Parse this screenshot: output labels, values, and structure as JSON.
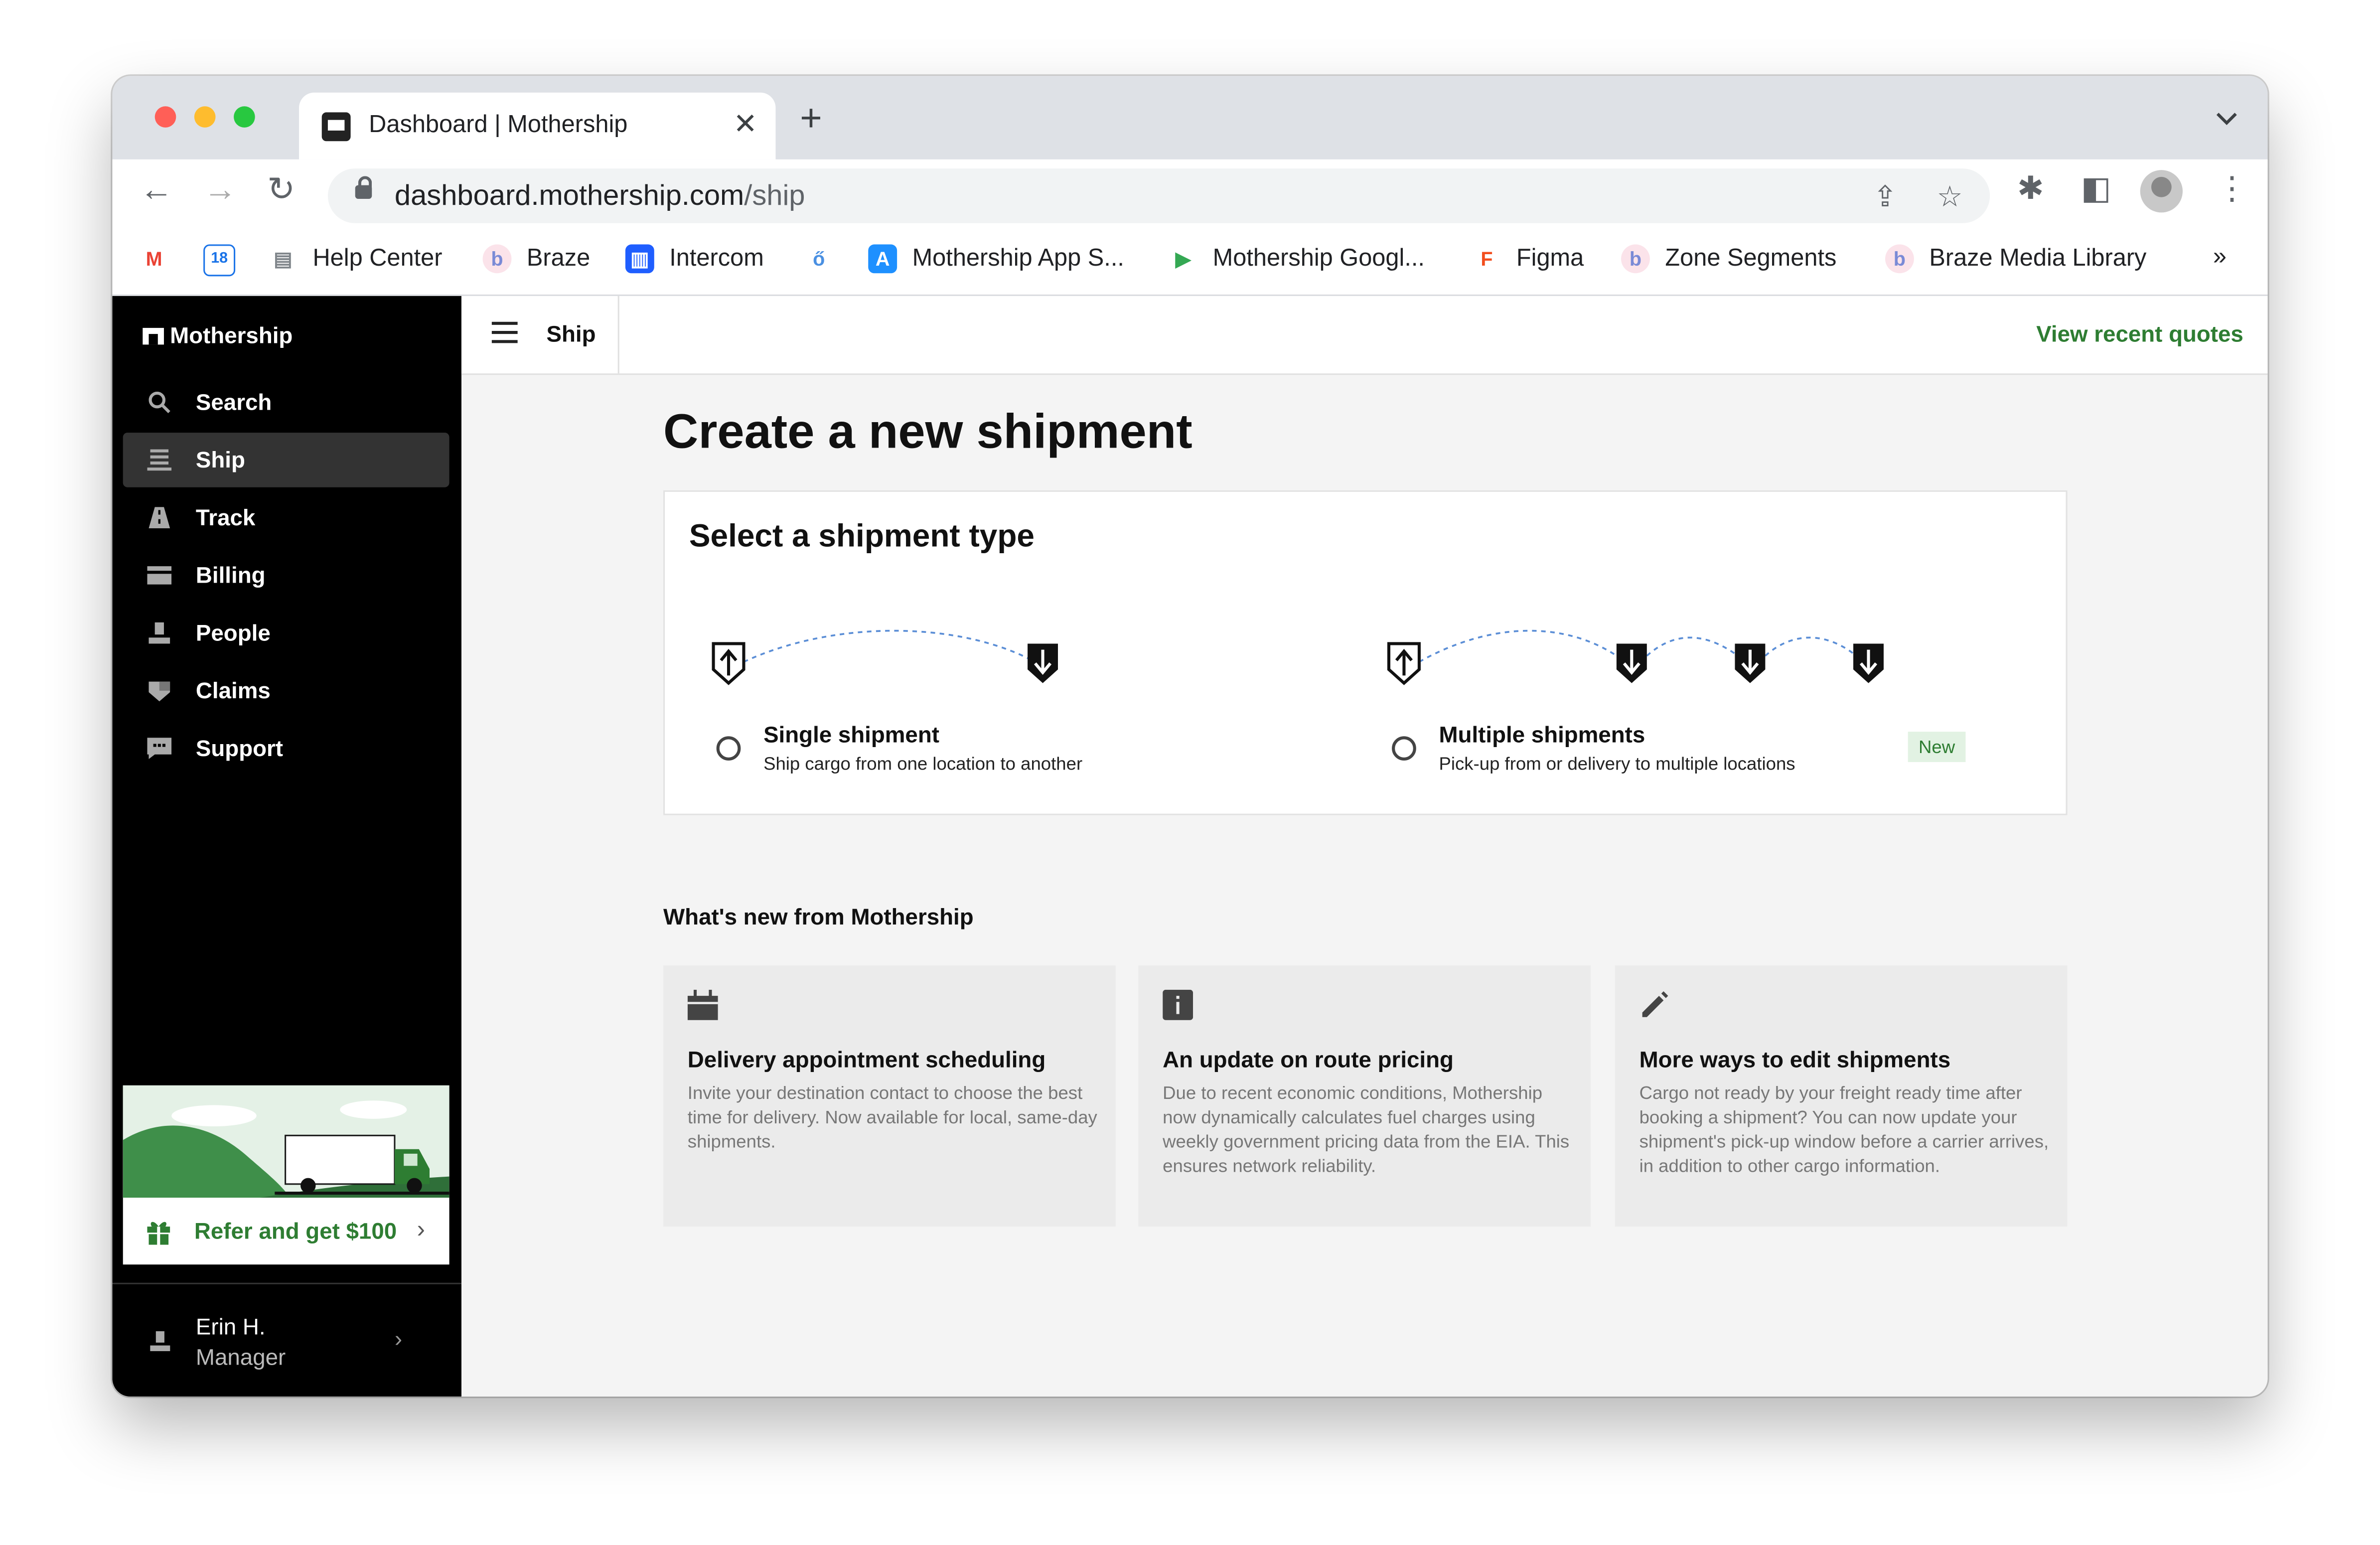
{
  "browser": {
    "tab_title": "Dashboard | Mothership",
    "tab_close": "✕",
    "new_tab": "+",
    "url_host": "dashboard.mothership.com",
    "url_path": "/ship",
    "bookmarks": [
      {
        "label": "",
        "icon": "gmail-icon",
        "color": "#ea4335",
        "glyph": "M"
      },
      {
        "label": "",
        "icon": "calendar-icon",
        "color": "#1a73e8",
        "glyph": "18"
      },
      {
        "label": "Help Center",
        "icon": "book-icon",
        "color": "#9aa0a6",
        "glyph": "▤"
      },
      {
        "label": "Braze",
        "icon": "braze-icon",
        "color": "#f4a6b8",
        "glyph": "b"
      },
      {
        "label": "Intercom",
        "icon": "intercom-icon",
        "color": "#1f5eff",
        "glyph": "▥"
      },
      {
        "label": "",
        "icon": "figure-icon",
        "color": "#4a90e2",
        "glyph": "ő"
      },
      {
        "label": "Mothership App S...",
        "icon": "app-store-icon",
        "color": "#1e90ff",
        "glyph": "A"
      },
      {
        "label": "Mothership Googl...",
        "icon": "google-play-icon",
        "color": "#34a853",
        "glyph": "▶"
      },
      {
        "label": "Figma",
        "icon": "figma-icon",
        "color": "#f24e1e",
        "glyph": "F"
      },
      {
        "label": "Zone Segments",
        "icon": "braze-icon",
        "color": "#f4a6b8",
        "glyph": "b"
      },
      {
        "label": "Braze Media Library",
        "icon": "braze-icon",
        "color": "#f4a6b8",
        "glyph": "b"
      }
    ],
    "more_bookmarks": "»"
  },
  "sidebar": {
    "logo": "Mothership",
    "items": [
      {
        "label": "Search",
        "icon": "search-icon",
        "glyph": "⚲",
        "active": false
      },
      {
        "label": "Ship",
        "icon": "ship-icon",
        "glyph": "☰",
        "active": true
      },
      {
        "label": "Track",
        "icon": "road-icon",
        "glyph": "▲",
        "active": false
      },
      {
        "label": "Billing",
        "icon": "credit-card-icon",
        "glyph": "▬",
        "active": false
      },
      {
        "label": "People",
        "icon": "person-icon",
        "glyph": "⏏",
        "active": false
      },
      {
        "label": "Claims",
        "icon": "shield-icon",
        "glyph": "⛉",
        "active": false
      },
      {
        "label": "Support",
        "icon": "chat-icon",
        "glyph": "▪",
        "active": false
      }
    ],
    "promo_label": "Refer and get $100",
    "promo_chevron": "›",
    "user_name": "Erin H.",
    "user_role": "Manager",
    "user_chevron": "›"
  },
  "header": {
    "title": "Ship",
    "recent_quotes": "View recent quotes"
  },
  "main": {
    "title": "Create a new shipment",
    "card_title": "Select a shipment type",
    "options": [
      {
        "title": "Single shipment",
        "subtitle": "Ship cargo from one location to another"
      },
      {
        "title": "Multiple shipments",
        "subtitle": "Pick-up from or delivery to multiple locations",
        "badge": "New"
      }
    ],
    "whats_new_title": "What's new from Mothership",
    "news": [
      {
        "icon": "calendar-icon",
        "title": "Delivery appointment scheduling",
        "body": "Invite your destination contact to choose the best time for delivery. Now available for local, same-day shipments."
      },
      {
        "icon": "info-icon",
        "title": "An update on route pricing",
        "body": "Due to recent economic conditions, Mothership now dynamically calculates fuel charges using weekly government pricing data from the EIA. This ensures network reliability."
      },
      {
        "icon": "pencil-icon",
        "title": "More ways to edit shipments",
        "body": "Cargo not ready by your freight ready time after booking a shipment? You can now update your shipment's pick-up window before a carrier arrives, in addition to other cargo information."
      }
    ]
  },
  "colors": {
    "accent_green": "#2e7d32",
    "sidebar_bg": "#000000",
    "active_item": "#333333",
    "route_line": "#5b8ed6"
  }
}
